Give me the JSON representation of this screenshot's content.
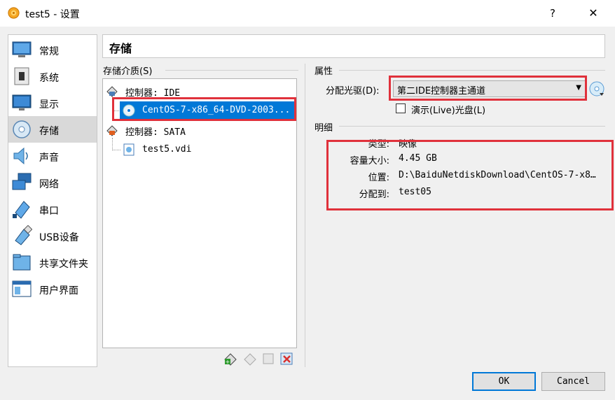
{
  "window": {
    "title": "test5 - 设置",
    "help": "?",
    "close": "✕"
  },
  "sidebar": {
    "items": [
      {
        "label": "常规",
        "icon": "general-icon"
      },
      {
        "label": "系统",
        "icon": "system-icon"
      },
      {
        "label": "显示",
        "icon": "display-icon"
      },
      {
        "label": "存储",
        "icon": "storage-icon",
        "selected": true
      },
      {
        "label": "声音",
        "icon": "audio-icon"
      },
      {
        "label": "网络",
        "icon": "network-icon"
      },
      {
        "label": "串口",
        "icon": "serial-port-icon"
      },
      {
        "label": "USB设备",
        "icon": "usb-icon"
      },
      {
        "label": "共享文件夹",
        "icon": "shared-folder-icon"
      },
      {
        "label": "用户界面",
        "icon": "user-interface-icon"
      }
    ]
  },
  "header": {
    "title": "存储"
  },
  "storage": {
    "label": "存储介质(S)",
    "tree": {
      "ide_controller": "控制器: IDE",
      "ide_disc": "CentOS-7-x86_64-DVD-2003...",
      "sata_controller": "控制器: SATA",
      "sata_disk": "test5.vdi"
    }
  },
  "properties": {
    "label": "属性",
    "drive_label": "分配光驱(D):",
    "drive_value": "第二IDE控制器主通道",
    "live_cd_label": "演示(Live)光盘(L)",
    "live_cd_checked": false
  },
  "details": {
    "label": "明细",
    "type_key": "类型:",
    "type_val": "映像",
    "size_key": "容量大小:",
    "size_val": "4.45 GB",
    "location_key": "位置:",
    "location_val": "D:\\BaiduNetdiskDownload\\CentOS-7-x8…",
    "attached_key": "分配到:",
    "attached_val": "test05"
  },
  "buttons": {
    "ok": "OK",
    "cancel": "Cancel"
  },
  "colors": {
    "selection": "#0078d7",
    "highlight_box": "#e0313b"
  }
}
